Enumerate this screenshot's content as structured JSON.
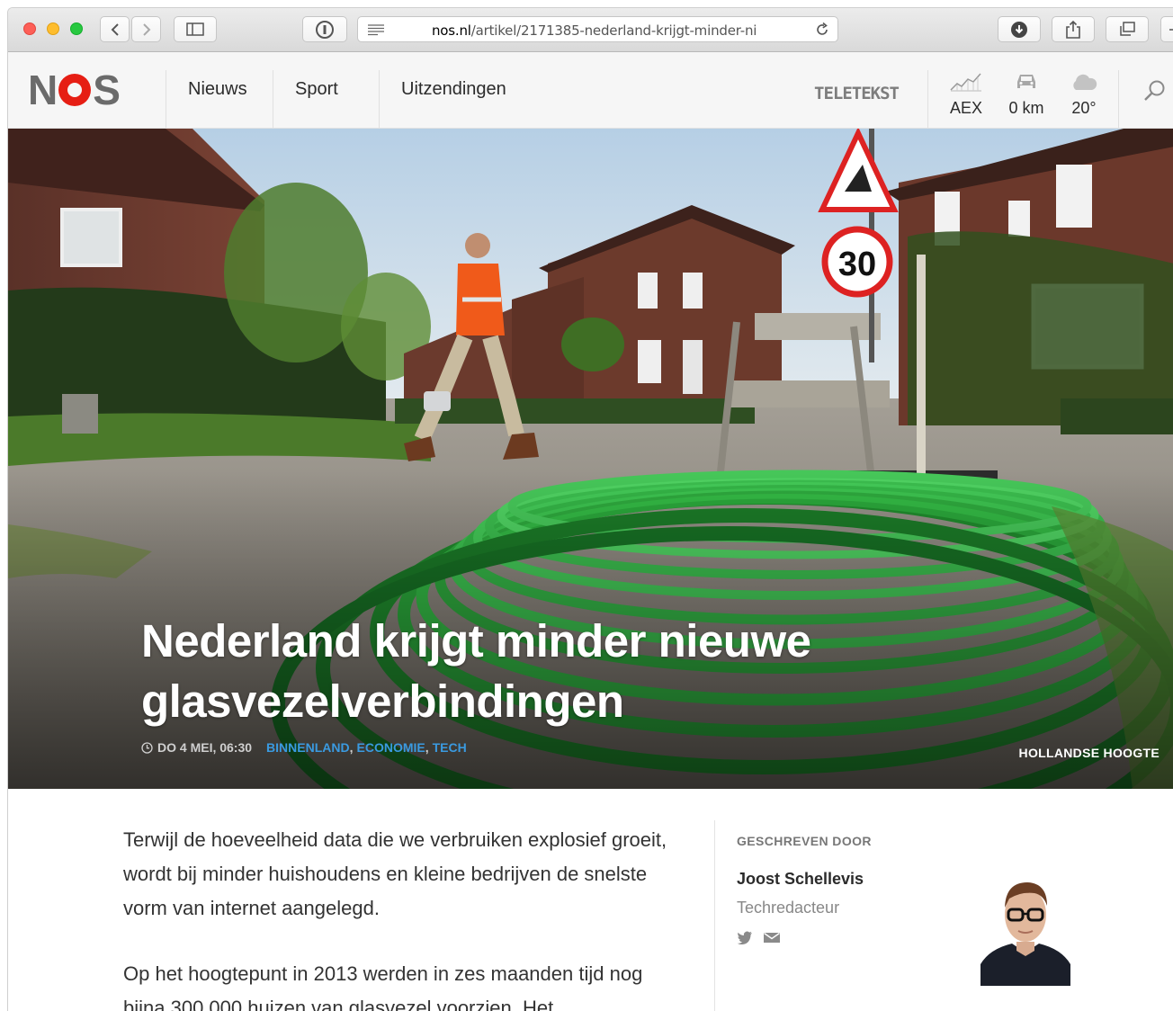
{
  "browser": {
    "url_host": "nos.nl",
    "url_path": "/artikel/2171385-nederland-krijgt-minder-ni"
  },
  "nav": {
    "logo": "NOS",
    "items": [
      {
        "label": "Nieuws"
      },
      {
        "label": "Sport"
      },
      {
        "label": "Uitzendingen"
      }
    ],
    "teletekst": "TELETEKST",
    "widgets": {
      "aex": "AEX",
      "traffic": "0 km",
      "weather": "20°"
    }
  },
  "hero": {
    "title": "Nederland krijgt minder nieuwe glasvezelverbindingen",
    "date": "DO 4 MEI, 06:30",
    "categories": [
      "BINNENLAND",
      "ECONOMIE",
      "TECH"
    ],
    "photo_credit": "HOLLANDSE HOOGTE",
    "sign_speed": "30"
  },
  "article": {
    "paragraphs": [
      "Terwijl de hoeveelheid data die we verbruiken explosief groeit, wordt bij minder huishoudens en kleine bedrijven de snelste vorm van internet aangelegd.",
      "Op het hoogtepunt in 2013 werden in zes maanden tijd nog bijna 300.000 huizen van glasvezel voorzien. Het"
    ]
  },
  "author": {
    "label": "GESCHREVEN DOOR",
    "name": "Joost Schellevis",
    "role": "Techredacteur"
  }
}
